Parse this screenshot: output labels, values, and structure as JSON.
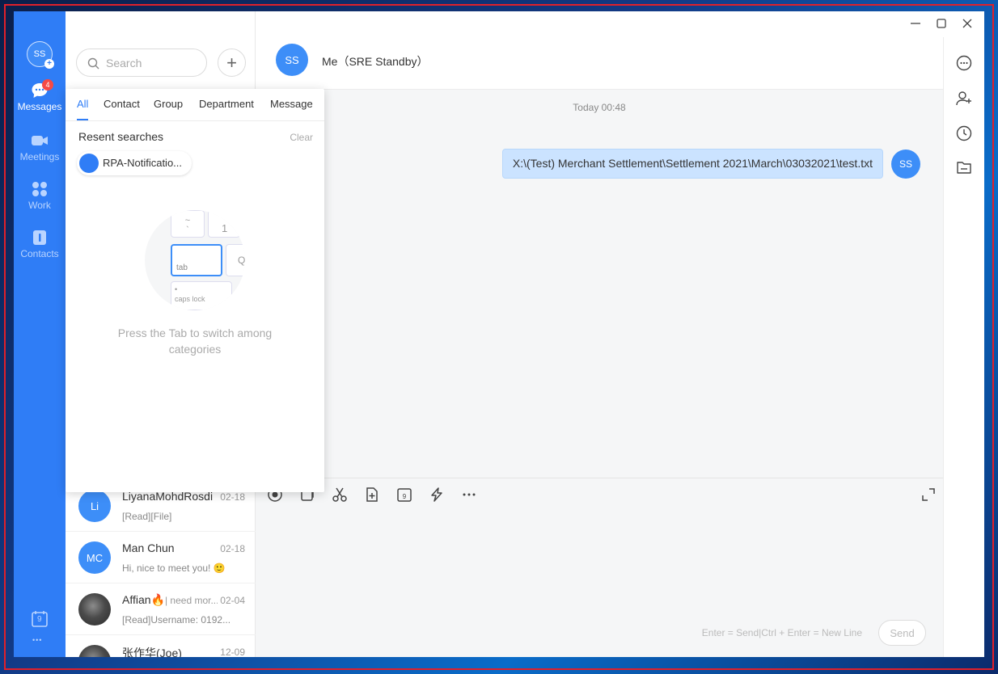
{
  "rail": {
    "avatar_initials": "SS",
    "messages_badge": "4",
    "items": [
      {
        "label": "Messages"
      },
      {
        "label": "Meetings"
      },
      {
        "label": "Work"
      },
      {
        "label": "Contacts"
      }
    ],
    "calendar_day": "9",
    "more": "•••"
  },
  "search": {
    "placeholder": "Search",
    "add_symbol": "+"
  },
  "popover": {
    "tabs": [
      "All",
      "Contact",
      "Group",
      "Department",
      "Message"
    ],
    "recent_title": "Resent searches",
    "clear_label": "Clear",
    "chip_label": "RPA-Notificatio...",
    "key_tilde": "~",
    "key_backtick": "`",
    "key_one": "1",
    "key_tab": "tab",
    "key_q": "Q",
    "key_dot": "•",
    "key_caps": "caps lock",
    "hint": "Press the Tab to switch among categories"
  },
  "conversations": [
    {
      "initials": "Li",
      "name": "LiyanaMohdRosdi",
      "note": "",
      "date": "02-18",
      "message": "[Read][File]"
    },
    {
      "initials": "MC",
      "name": "Man Chun",
      "note": "",
      "date": "02-18",
      "message": "Hi, nice to meet you! 🙂"
    },
    {
      "initials": "",
      "name": "Affian🔥",
      "note": "| need mor...",
      "date": "02-04",
      "message": "[Read]Username: 0192..."
    },
    {
      "initials": "",
      "name": "张作华(Joe)",
      "note": "",
      "date": "12-09",
      "message": ""
    }
  ],
  "chat": {
    "header_initials": "SS",
    "title": "Me（SRE Standby）",
    "timestamp": "Today 00:48",
    "message": "X:\\(Test) Merchant Settlement\\Settlement 2021\\March\\03032021\\test.txt",
    "sender_initials": "SS",
    "send_hint": "Enter = Send|Ctrl + Enter = New Line",
    "send_label": "Send",
    "toolbar_icons": [
      "emoji-icon",
      "screenshot-icon",
      "scissors-icon",
      "file-upload-icon",
      "calendar-icon",
      "quick-reply-icon",
      "more-icon"
    ]
  },
  "colors": {
    "accent": "#2f7df6",
    "bubble": "#cbe3ff",
    "badge": "#f54a45"
  }
}
